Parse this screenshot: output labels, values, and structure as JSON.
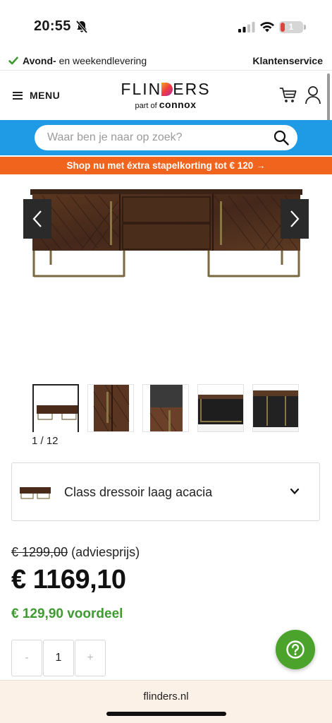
{
  "status_bar": {
    "time": "20:55",
    "battery": "1"
  },
  "delivery_bar": {
    "bold_text": "Avond-",
    "text": " en weekendlevering",
    "customer_service": "Klantenservice"
  },
  "header": {
    "menu_label": "MENU",
    "logo_brand_left": "FLIN",
    "logo_brand_right": "ERS",
    "logo_sub": "part of ",
    "logo_parent": "connox"
  },
  "search": {
    "placeholder": "Waar ben je naar op zoek?"
  },
  "promo": {
    "text": "Shop nu met éxtra stapelkorting tot € 120 →"
  },
  "gallery": {
    "counter": "1 / 12"
  },
  "variant": {
    "name": "Class dressoir laag acacia"
  },
  "pricing": {
    "old_price": "€ 1299,00",
    "old_price_note": " (adviesprijs)",
    "price": "€ 1169,10",
    "saving": "€ 129,90 voordeel"
  },
  "quantity": {
    "minus": "-",
    "value": "1",
    "plus": "+"
  },
  "browser": {
    "url": "flinders.nl"
  },
  "colors": {
    "search_bar": "#1f9be6",
    "promo": "#f0641e",
    "saving": "#3f9a32",
    "help_button": "#4ca32c",
    "wood": "#4a2b1a",
    "brass": "#8a7545"
  },
  "icons": {
    "menu": "hamburger-icon",
    "cart": "cart-icon",
    "user": "user-icon",
    "search": "search-icon",
    "prev": "chevron-left-icon",
    "next": "chevron-right-icon",
    "dropdown": "chevron-down-icon",
    "help": "question-icon"
  }
}
